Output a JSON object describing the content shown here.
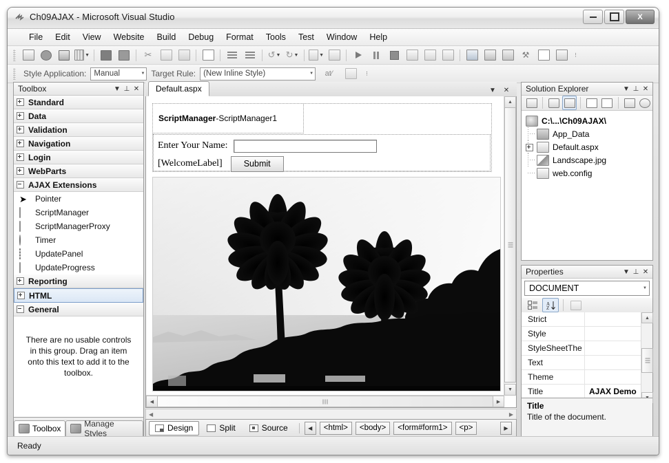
{
  "window": {
    "title": "Ch09AJAX - Microsoft Visual Studio",
    "logo_icon": "vs-logo-icon",
    "minimize_label": "Minimize",
    "maximize_label": "Maximize",
    "close_label": "X"
  },
  "menubar": {
    "items": [
      {
        "label": "File"
      },
      {
        "label": "Edit"
      },
      {
        "label": "View"
      },
      {
        "label": "Website"
      },
      {
        "label": "Build"
      },
      {
        "label": "Debug"
      },
      {
        "label": "Format"
      },
      {
        "label": "Tools"
      },
      {
        "label": "Test"
      },
      {
        "label": "Window"
      },
      {
        "label": "Help"
      }
    ]
  },
  "toolbar": {
    "buttons": [
      {
        "name": "new-item-icon"
      },
      {
        "name": "new-website-icon"
      },
      {
        "name": "open-file-icon"
      },
      {
        "name": "add-item-icon"
      },
      {
        "name": "save-icon"
      },
      {
        "name": "save-all-icon"
      },
      {
        "name": "cut-icon"
      },
      {
        "name": "copy-icon"
      },
      {
        "name": "paste-icon"
      },
      {
        "name": "find-replace-icon"
      },
      {
        "name": "indent-icon"
      },
      {
        "name": "outdent-icon"
      },
      {
        "name": "undo-icon"
      },
      {
        "name": "redo-icon"
      },
      {
        "name": "navigate-backward-icon"
      },
      {
        "name": "navigate-forward-icon"
      },
      {
        "name": "start-debugging-icon"
      },
      {
        "name": "pause-icon"
      },
      {
        "name": "stop-icon"
      },
      {
        "name": "step-into-icon"
      },
      {
        "name": "step-over-icon"
      },
      {
        "name": "step-out-icon"
      },
      {
        "name": "solution-explorer-icon"
      },
      {
        "name": "properties-window-icon"
      },
      {
        "name": "object-browser-icon"
      },
      {
        "name": "toolbox-icon"
      },
      {
        "name": "error-list-icon"
      },
      {
        "name": "output-window-icon"
      }
    ]
  },
  "style_toolbar": {
    "style_application_label": "Style Application:",
    "style_application_value": "Manual",
    "target_rule_label": "Target Rule:",
    "target_rule_value": "(New Inline Style)",
    "attach_style_sheet_icon": "attach-style-sheet-icon",
    "new_style_icon": "new-style-icon"
  },
  "toolbox": {
    "title": "Toolbox",
    "dropdown_icon": "chevron-down-icon",
    "pin_icon": "pin-icon",
    "close_icon": "close-icon",
    "categories": [
      {
        "label": "Standard",
        "expanded": false
      },
      {
        "label": "Data",
        "expanded": false
      },
      {
        "label": "Validation",
        "expanded": false
      },
      {
        "label": "Navigation",
        "expanded": false
      },
      {
        "label": "Login",
        "expanded": false
      },
      {
        "label": "WebParts",
        "expanded": false
      },
      {
        "label": "AJAX Extensions",
        "expanded": true
      }
    ],
    "ajax_items": [
      {
        "label": "Pointer",
        "icon": "pointer-icon"
      },
      {
        "label": "ScriptManager",
        "icon": "script-manager-icon"
      },
      {
        "label": "ScriptManagerProxy",
        "icon": "script-manager-proxy-icon"
      },
      {
        "label": "Timer",
        "icon": "timer-icon"
      },
      {
        "label": "UpdatePanel",
        "icon": "update-panel-icon"
      },
      {
        "label": "UpdateProgress",
        "icon": "update-progress-icon"
      }
    ],
    "categories_after": [
      {
        "label": "Reporting",
        "expanded": false
      },
      {
        "label": "HTML",
        "expanded": false,
        "selected": true
      },
      {
        "label": "General",
        "expanded": true
      }
    ],
    "empty_message": "There are no usable controls in this group. Drag an item onto this text to add it to the toolbox.",
    "tabs": [
      {
        "label": "Toolbox",
        "icon": "toolbox-icon",
        "active": true
      },
      {
        "label": "Manage Styles",
        "icon": "manage-styles-icon",
        "active": false
      }
    ]
  },
  "editor": {
    "tab_label": "Default.aspx",
    "dropdown_icon": "chevron-down-icon",
    "close_icon": "close-icon",
    "script_manager": {
      "type": "ScriptManager",
      "separator": " - ",
      "id": "ScriptManager1"
    },
    "form": {
      "name_label": "Enter Your Name:",
      "name_input_value": "",
      "welcome_label": "[WelcomeLabel]",
      "submit_label": "Submit"
    },
    "image_alt": "Landscape.jpg black and white photo of two palm trees silhouetted against a bright sky"
  },
  "view_tabs": {
    "tabs": [
      {
        "label": "Design",
        "icon": "design-view-icon",
        "active": true
      },
      {
        "label": "Split",
        "icon": "split-view-icon",
        "active": false
      },
      {
        "label": "Source",
        "icon": "source-view-icon",
        "active": false
      }
    ],
    "prev_icon": "chevron-left-icon",
    "next_icon": "chevron-right-icon",
    "tags": [
      "<html>",
      "<body>",
      "<form#form1>",
      "<p>"
    ]
  },
  "solution_explorer": {
    "title": "Solution Explorer",
    "dropdown_icon": "chevron-down-icon",
    "pin_icon": "pin-icon",
    "close_icon": "close-icon",
    "toolbar_buttons": [
      {
        "name": "properties-icon"
      },
      {
        "name": "refresh-icon"
      },
      {
        "name": "nest-related-files-icon",
        "selected": true
      },
      {
        "name": "view-code-icon"
      },
      {
        "name": "view-designer-icon"
      },
      {
        "name": "copy-website-icon"
      },
      {
        "name": "aspnet-configuration-icon"
      }
    ],
    "tree": [
      {
        "label": "C:\\...\\Ch09AJAX\\",
        "icon": "project-icon",
        "level": 0,
        "expander": false
      },
      {
        "label": "App_Data",
        "icon": "folder-icon",
        "level": 1,
        "expander": false
      },
      {
        "label": "Default.aspx",
        "icon": "aspx-file-icon",
        "level": 1,
        "expander": true
      },
      {
        "label": "Landscape.jpg",
        "icon": "image-file-icon",
        "level": 1,
        "expander": false
      },
      {
        "label": "web.config",
        "icon": "config-file-icon",
        "level": 1,
        "expander": false
      }
    ]
  },
  "properties": {
    "title": "Properties",
    "dropdown_icon": "chevron-down-icon",
    "pin_icon": "pin-icon",
    "close_icon": "close-icon",
    "object_selector_value": "DOCUMENT",
    "object_selector_arrow": "chevron-down-icon",
    "toolbar_buttons": [
      {
        "name": "categorized-icon",
        "selected": false
      },
      {
        "name": "alphabetical-icon",
        "selected": true
      },
      {
        "name": "property-pages-icon",
        "selected": false
      }
    ],
    "rows": [
      {
        "name": "Strict",
        "value": ""
      },
      {
        "name": "Style",
        "value": ""
      },
      {
        "name": "StyleSheetThe",
        "value": ""
      },
      {
        "name": "Text",
        "value": ""
      },
      {
        "name": "Theme",
        "value": ""
      },
      {
        "name": "Title",
        "value": "AJAX Demo"
      }
    ],
    "description_title": "Title",
    "description_text": "Title of the document."
  },
  "statusbar": {
    "text": "Ready"
  }
}
